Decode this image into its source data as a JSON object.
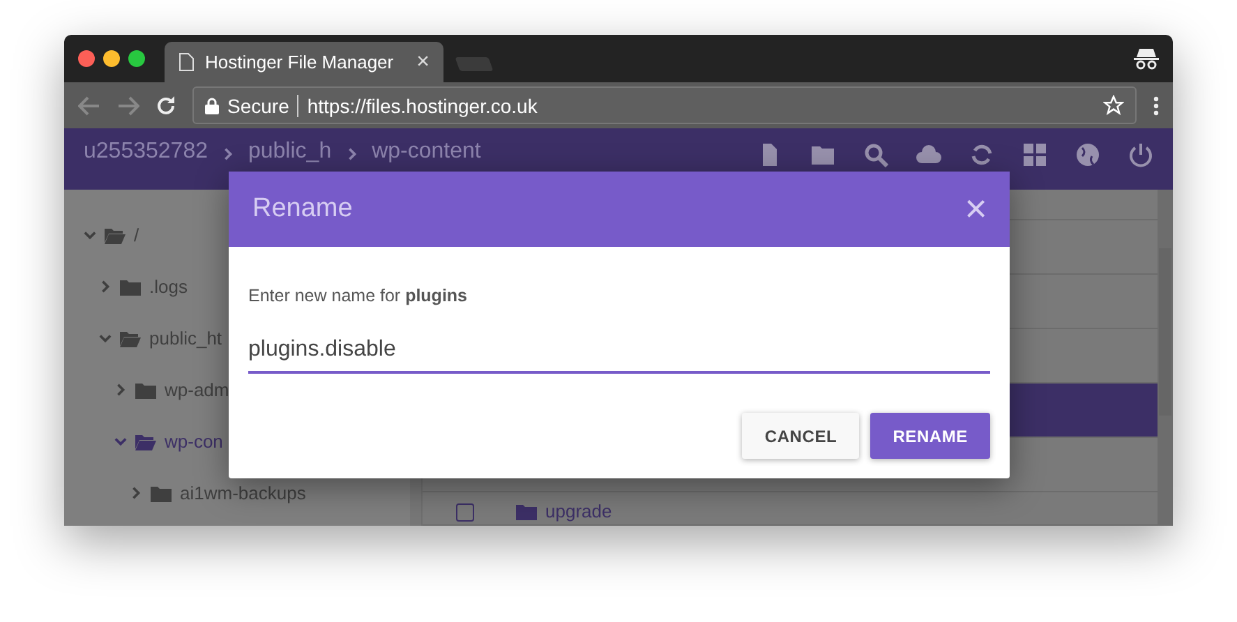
{
  "browser": {
    "tab_title": "Hostinger File Manager",
    "tab_close": "×",
    "secure_label": "Secure",
    "url": "https://files.hostinger.co.uk"
  },
  "breadcrumbs": [
    "u255352782",
    "public_h",
    "wp-content"
  ],
  "tree": [
    {
      "name": "/",
      "expanded": true,
      "selected": false,
      "children": [
        {
          "name": ".logs",
          "expanded": false,
          "selected": false
        },
        {
          "name": "public_ht",
          "expanded": true,
          "selected": false,
          "children": [
            {
              "name": "wp-adm",
              "expanded": false,
              "selected": false
            },
            {
              "name": "wp-con",
              "expanded": true,
              "selected": true,
              "children": [
                {
                  "name": "ai1wm-backups",
                  "expanded": false,
                  "selected": false
                }
              ]
            }
          ]
        }
      ]
    }
  ],
  "file_rows": [
    {
      "selected": false
    },
    {
      "selected": false
    },
    {
      "selected": false
    },
    {
      "selected": true
    },
    {
      "selected": false
    },
    {
      "name": "upgrade",
      "selected": false,
      "checked": false
    }
  ],
  "dialog": {
    "title": "Rename",
    "close": "×",
    "prompt": "Enter new name for **plugins**",
    "value": "plugins.disable",
    "buttons": [
      {
        "label": "CANCEL",
        "kind": "secondary"
      },
      {
        "label": "RENAME",
        "kind": "primary"
      }
    ]
  }
}
